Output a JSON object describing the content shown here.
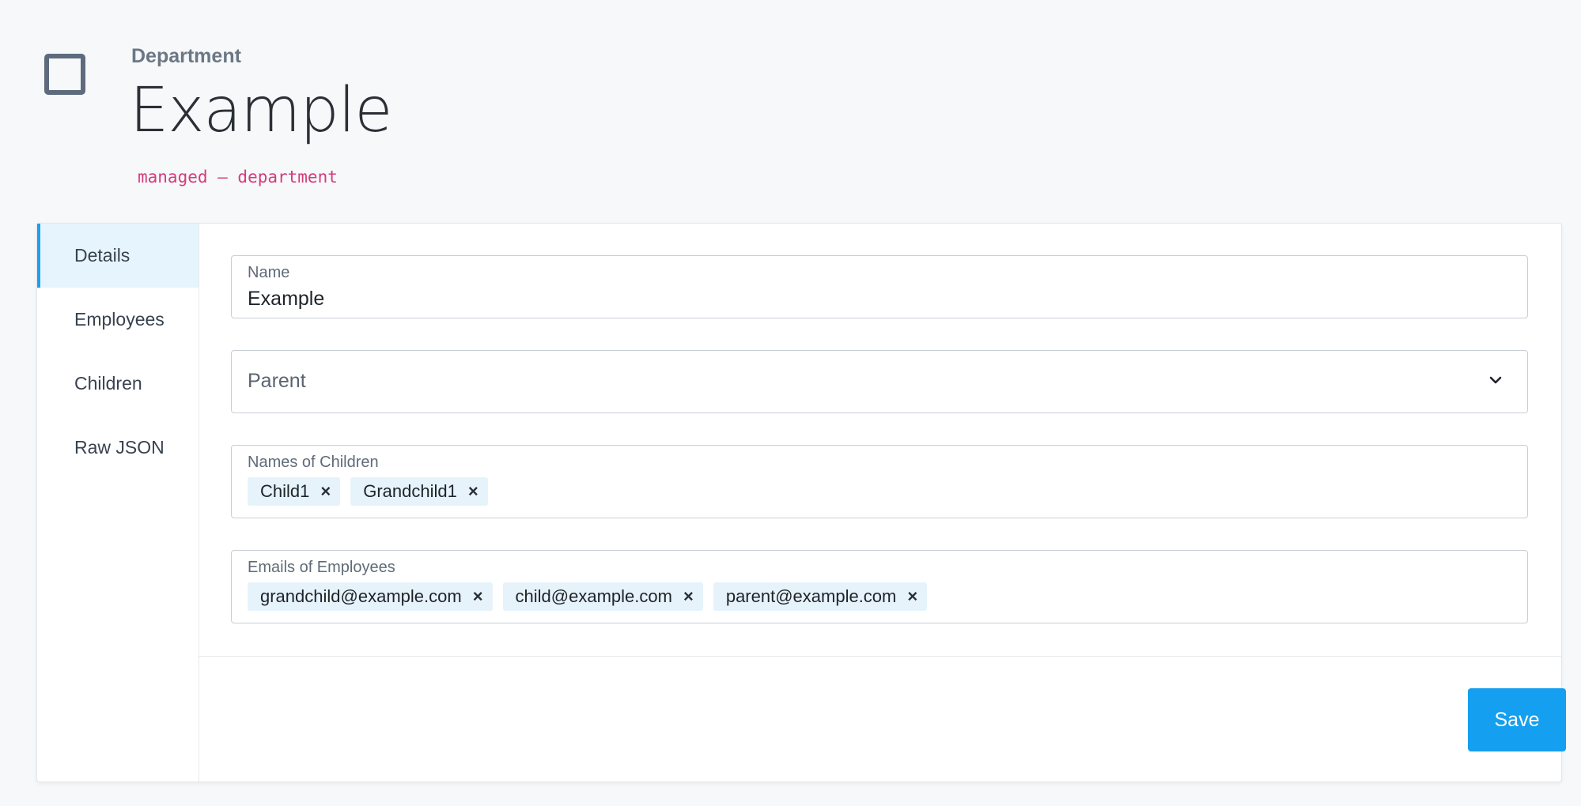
{
  "header": {
    "eyebrow": "Department",
    "title": "Example",
    "tag": "managed – department",
    "icon": "square-icon"
  },
  "sidebar": {
    "items": [
      {
        "label": "Details",
        "active": true
      },
      {
        "label": "Employees",
        "active": false
      },
      {
        "label": "Children",
        "active": false
      },
      {
        "label": "Raw JSON",
        "active": false
      }
    ]
  },
  "form": {
    "name": {
      "label": "Name",
      "value": "Example"
    },
    "parent": {
      "placeholder": "Parent",
      "icon": "chevron-down-icon"
    },
    "children": {
      "label": "Names of Children",
      "chips": [
        "Child1",
        "Grandchild1"
      ]
    },
    "employees": {
      "label": "Emails of Employees",
      "chips": [
        "grandchild@example.com",
        "child@example.com",
        "parent@example.com"
      ]
    },
    "remove_glyph": "×"
  },
  "actions": {
    "save_label": "Save"
  },
  "colors": {
    "accent": "#149ff0",
    "tag": "#d63a7b",
    "chip_bg": "#e6f3fb",
    "active_bg": "#e6f5fd"
  }
}
